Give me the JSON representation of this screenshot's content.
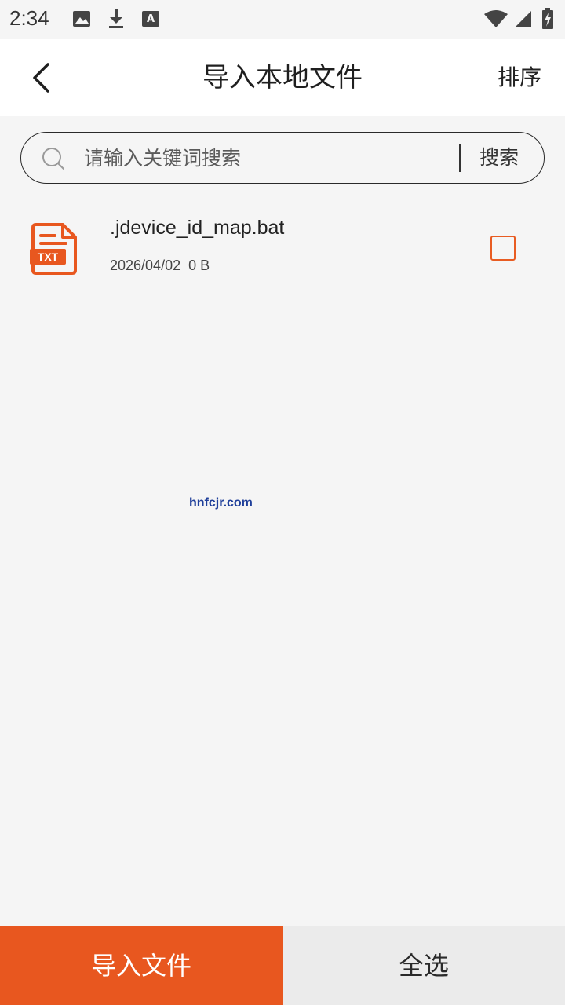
{
  "status_bar": {
    "time": "2:34",
    "left_icons": [
      "image-icon",
      "download-icon",
      "font-a-icon"
    ],
    "right_icons": [
      "wifi-icon",
      "signal-icon",
      "battery-charging-icon"
    ]
  },
  "header": {
    "back_icon": "back-arrow-icon",
    "title": "导入本地文件",
    "sort_label": "排序"
  },
  "search": {
    "placeholder": "请输入关键词搜索",
    "button_label": "搜索"
  },
  "files": [
    {
      "icon": "txt-file-icon",
      "icon_text": "TXT",
      "name": ".jdevice_id_map.bat",
      "meta": "2026/04/02  0 B",
      "checked": false
    }
  ],
  "watermark": "hnfcjr.com",
  "footer": {
    "import_label": "导入文件",
    "select_all_label": "全选"
  },
  "colors": {
    "accent": "#e8571f",
    "background": "#f5f5f5",
    "header_bg": "#ffffff",
    "select_all_bg": "#ebebeb"
  }
}
